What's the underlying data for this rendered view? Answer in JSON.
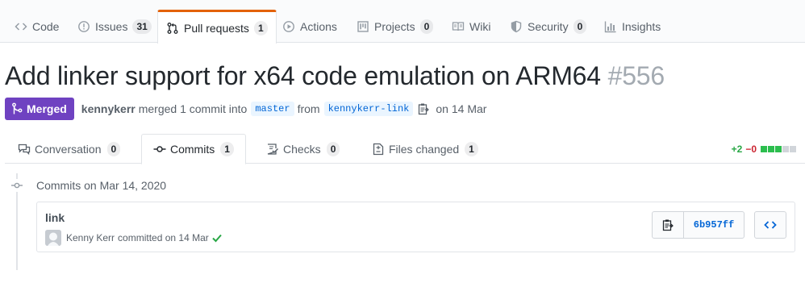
{
  "repo_nav": {
    "tabs": [
      {
        "label": "Code",
        "icon": "code-icon",
        "count": null
      },
      {
        "label": "Issues",
        "icon": "issue-opened-icon",
        "count": "31"
      },
      {
        "label": "Pull requests",
        "icon": "git-pull-request-icon",
        "count": "1",
        "selected": true
      },
      {
        "label": "Actions",
        "icon": "play-icon",
        "count": null
      },
      {
        "label": "Projects",
        "icon": "project-icon",
        "count": "0"
      },
      {
        "label": "Wiki",
        "icon": "book-icon",
        "count": null
      },
      {
        "label": "Security",
        "icon": "shield-icon",
        "count": "0"
      },
      {
        "label": "Insights",
        "icon": "graph-icon",
        "count": null
      }
    ]
  },
  "pr": {
    "title": "Add linker support for x64 code emulation on ARM64",
    "number": "#556",
    "state": "Merged",
    "author": "kennykerr",
    "merged_text": "merged 1 commit into",
    "base_branch": "master",
    "from_text": "from",
    "head_branch": "kennykerr-link",
    "date_text": "on 14 Mar"
  },
  "pr_tabs": [
    {
      "label": "Conversation",
      "icon": "comment-discussion-icon",
      "count": "0"
    },
    {
      "label": "Commits",
      "icon": "git-commit-icon",
      "count": "1",
      "selected": true
    },
    {
      "label": "Checks",
      "icon": "checklist-icon",
      "count": "0"
    },
    {
      "label": "Files changed",
      "icon": "file-diff-icon",
      "count": "1"
    }
  ],
  "diffstat": {
    "additions": "+2",
    "deletions": "−0",
    "green_blocks": 3,
    "total_blocks": 5
  },
  "timeline": {
    "heading": "Commits on Mar 14, 2020",
    "commit": {
      "message": "link",
      "author": "Kenny Kerr",
      "committed_text": "committed on 14 Mar",
      "sha": "6b957ff",
      "status": "success"
    }
  },
  "colors": {
    "accent_orange": "#e36209",
    "merged_purple": "#6f42c1",
    "link_blue": "#0366d6",
    "success_green": "#28a745",
    "danger_red": "#cb2431"
  }
}
